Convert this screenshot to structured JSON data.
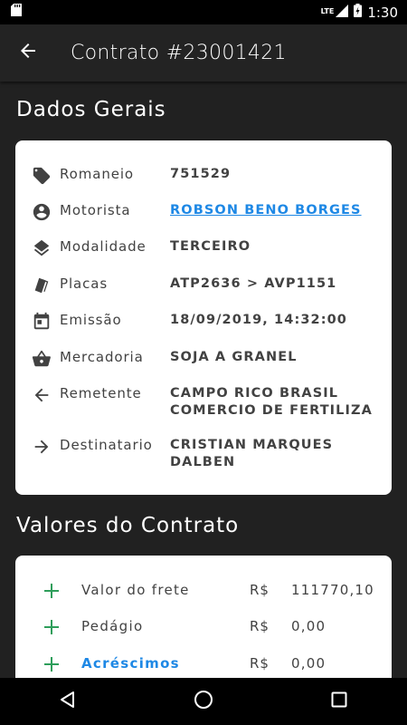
{
  "status_bar": {
    "network": "LTE",
    "time": "1:30"
  },
  "app_bar": {
    "title": "Contrato #23001421"
  },
  "dados_gerais": {
    "title": "Dados Gerais",
    "rows": [
      {
        "icon": "tag-icon",
        "label": "Romaneio",
        "value": "751529"
      },
      {
        "icon": "account-circle-icon",
        "label": "Motorista",
        "value": "ROBSON BENO BORGES"
      },
      {
        "icon": "layers-icon",
        "label": "Modalidade",
        "value": "TERCEIRO"
      },
      {
        "icon": "cards-icon",
        "label": "Placas",
        "value": "ATP2636 > AVP1151"
      },
      {
        "icon": "calendar-icon",
        "label": "Emissão",
        "value": "18/09/2019, 14:32:00"
      },
      {
        "icon": "basket-icon",
        "label": "Mercadoria",
        "value": "SOJA A GRANEL"
      },
      {
        "icon": "arrow-left-icon",
        "label": "Remetente",
        "value_line1": "CAMPO RICO BRASIL",
        "value_line2": "COMERCIO DE FERTILIZA"
      },
      {
        "icon": "arrow-right-icon",
        "label": "Destinatario",
        "value_line1": "CRISTIAN MARQUES",
        "value_line2": "DALBEN"
      }
    ]
  },
  "valores": {
    "title": "Valores do Contrato",
    "rows": [
      {
        "label": "Valor do frete",
        "currency": "R$",
        "amount": "111770,10"
      },
      {
        "label": "Pedágio",
        "currency": "R$",
        "amount": "0,00"
      },
      {
        "label": "Acréscimos",
        "currency": "R$",
        "amount": "0,00"
      }
    ]
  },
  "colors": {
    "accent": "#1e88e5",
    "plus": "#2e9e5b",
    "background": "#212121",
    "card": "#ffffff"
  }
}
